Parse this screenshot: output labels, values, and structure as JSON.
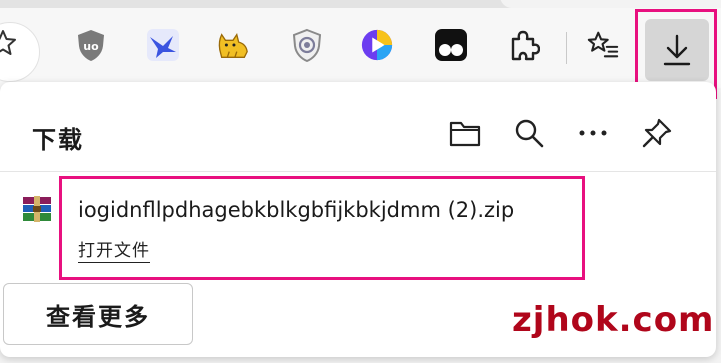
{
  "toolbar": {
    "icons": [
      "favorites-star-icon",
      "ublock-origin-icon",
      "swift-bird-icon",
      "yellow-cat-icon",
      "shield-extension-icon",
      "media-play-icon",
      "tampermonkey-icon",
      "extensions-puzzle-icon",
      "favorites-list-icon",
      "downloads-icon"
    ]
  },
  "extensions": {
    "ublock_label": "uo"
  },
  "downloads_panel": {
    "title": "下载",
    "item": {
      "file_name": "iogidnfllpdhagebkblkgbfijkbkjdmm (2).zip",
      "open_label": "打开文件"
    },
    "see_more_label": "查看更多"
  },
  "watermark": "zjhok.com",
  "colors": {
    "highlight": "#e8107f",
    "watermark": "#b0061b",
    "download_button_bg": "#d6d6d6"
  }
}
